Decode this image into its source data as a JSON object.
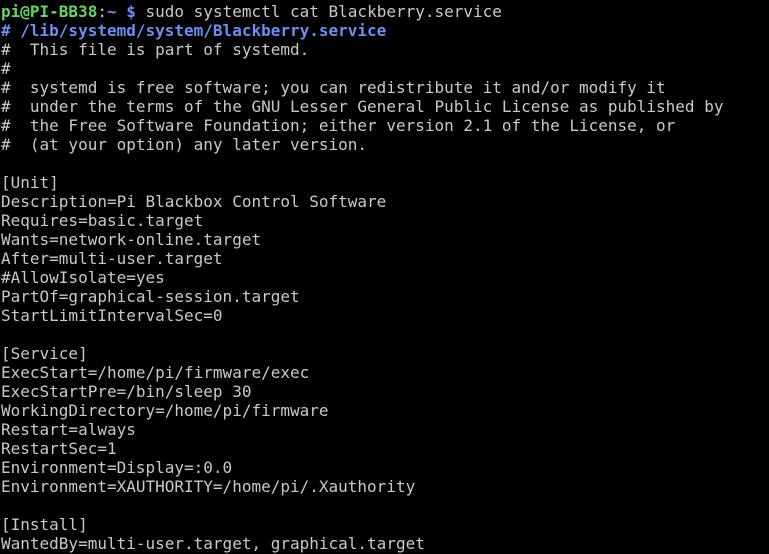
{
  "prompt": {
    "user_host": "pi@PI-BB38",
    "separator": ":",
    "cwd": "~",
    "dollar": " $",
    "command": " sudo systemctl cat Blackberry.service"
  },
  "colors": {
    "prompt_user": "#5fd75f",
    "prompt_path": "#6a8ff5",
    "text": "#c9c9c9",
    "background": "#000000"
  },
  "lines": [
    "# /lib/systemd/system/Blackberry.service",
    "#  This file is part of systemd.",
    "#",
    "#  systemd is free software; you can redistribute it and/or modify it",
    "#  under the terms of the GNU Lesser General Public License as published by",
    "#  the Free Software Foundation; either version 2.1 of the License, or",
    "#  (at your option) any later version.",
    "",
    "[Unit]",
    "Description=Pi Blackbox Control Software",
    "Requires=basic.target",
    "Wants=network-online.target",
    "After=multi-user.target",
    "#AllowIsolate=yes",
    "PartOf=graphical-session.target",
    "StartLimitIntervalSec=0",
    "",
    "[Service]",
    "ExecStart=/home/pi/firmware/exec",
    "ExecStartPre=/bin/sleep 30",
    "WorkingDirectory=/home/pi/firmware",
    "Restart=always",
    "RestartSec=1",
    "Environment=Display=:0.0",
    "Environment=XAUTHORITY=/home/pi/.Xauthority",
    "",
    "[Install]",
    "WantedBy=multi-user.target, graphical.target"
  ]
}
